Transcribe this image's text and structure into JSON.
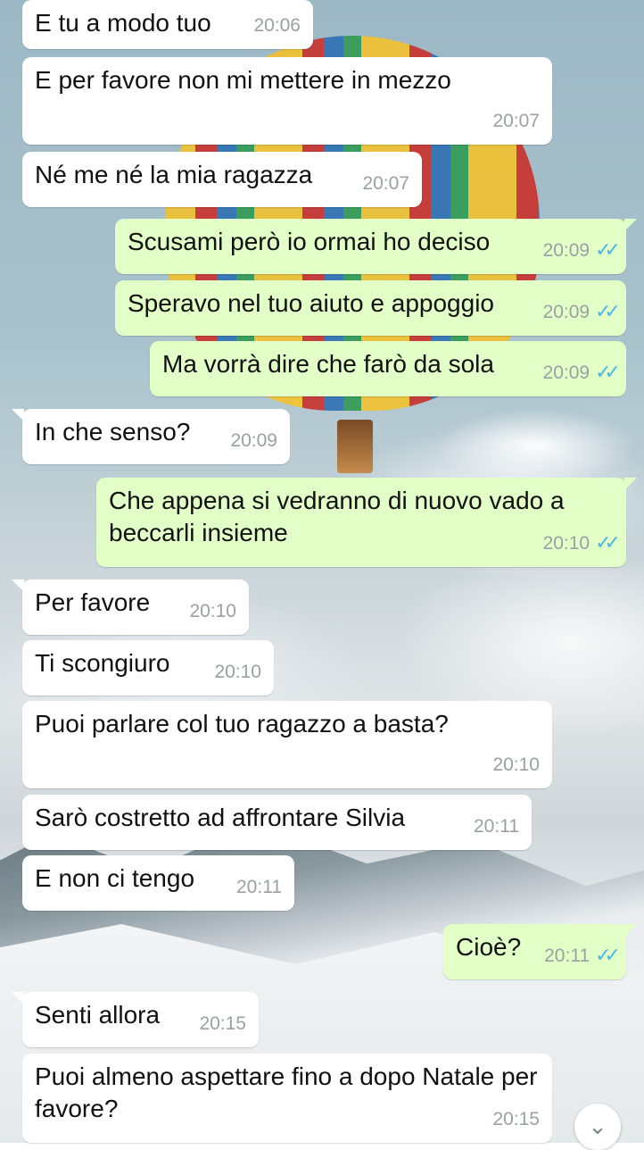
{
  "messages": [
    {
      "dir": "in",
      "text": "E tu a modo tuo",
      "time": "20:06"
    },
    {
      "dir": "in",
      "text": "E per favore non mi mettere in mezzo",
      "time": "20:07"
    },
    {
      "dir": "in",
      "text": "Né me né la mia ragazza",
      "time": "20:07"
    },
    {
      "dir": "out",
      "text": "Scusami però io ormai ho deciso",
      "time": "20:09",
      "status": "read"
    },
    {
      "dir": "out",
      "text": "Speravo nel tuo aiuto e appoggio",
      "time": "20:09",
      "status": "read"
    },
    {
      "dir": "out",
      "text": "Ma vorrà dire che farò da sola",
      "time": "20:09",
      "status": "read"
    },
    {
      "dir": "in",
      "text": "In che senso?",
      "time": "20:09"
    },
    {
      "dir": "out",
      "text": "Che appena si vedranno di nuovo vado a beccarli insieme",
      "time": "20:10",
      "status": "read"
    },
    {
      "dir": "in",
      "text": "Per favore",
      "time": "20:10"
    },
    {
      "dir": "in",
      "text": "Ti scongiuro",
      "time": "20:10"
    },
    {
      "dir": "in",
      "text": "Puoi parlare col tuo ragazzo a basta?",
      "time": "20:10"
    },
    {
      "dir": "in",
      "text": "Sarò costretto ad affrontare Silvia",
      "time": "20:11"
    },
    {
      "dir": "in",
      "text": "E non ci tengo",
      "time": "20:11"
    },
    {
      "dir": "out",
      "text": "Cioè?",
      "time": "20:11",
      "status": "read"
    },
    {
      "dir": "in",
      "text": "Senti allora",
      "time": "20:15"
    },
    {
      "dir": "in",
      "text": "Puoi almeno aspettare fino a dopo Natale per favore?",
      "time": "20:15"
    }
  ],
  "icons": {
    "read_ticks": "double-check-icon",
    "scroll_down": "chevron-double-down-icon"
  },
  "colors": {
    "incoming_bubble": "#ffffff",
    "outgoing_bubble": "#e2ffc7",
    "timestamp": "#9aa0a3",
    "read_ticks": "#4fb6ec"
  }
}
